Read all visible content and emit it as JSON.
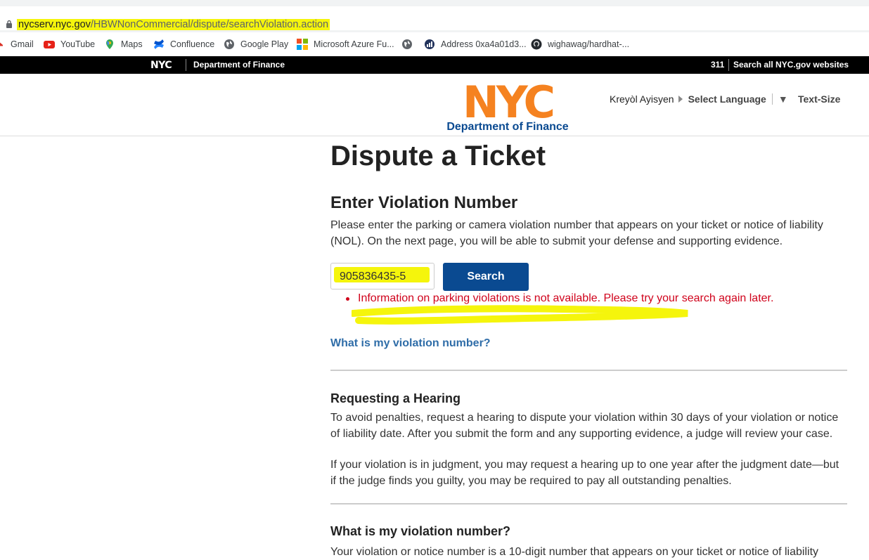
{
  "browser": {
    "url_domain": "nycserv.nyc.gov",
    "url_path": "/HBWNonCommercial/dispute/searchViolation.action",
    "bookmarks": [
      {
        "label": "Gmail",
        "icon": "gmail-icon"
      },
      {
        "label": "YouTube",
        "icon": "youtube-icon"
      },
      {
        "label": "Maps",
        "icon": "maps-icon"
      },
      {
        "label": "Confluence",
        "icon": "confluence-icon"
      },
      {
        "label": "Google Play",
        "icon": "globe-icon"
      },
      {
        "label": "Microsoft Azure Fu...",
        "icon": "microsoft-icon"
      },
      {
        "label": "",
        "icon": "globe-icon"
      },
      {
        "label": "Address 0xa4a01d3...",
        "icon": "etherscan-icon"
      },
      {
        "label": "wighawag/hardhat-...",
        "icon": "github-icon"
      }
    ]
  },
  "topbar": {
    "logo": "NYC",
    "department": "Department of Finance",
    "link_311": "311",
    "search_all": "Search all NYC.gov websites"
  },
  "header": {
    "logo_text": "NYC",
    "logo_subtitle": "Department of Finance",
    "language_current": "Kreyòl Ayisyen",
    "select_language": "Select Language",
    "text_size": "Text-Size"
  },
  "main": {
    "title": "Dispute a Ticket",
    "section_title": "Enter Violation Number",
    "intro": "Please enter the parking or camera violation number that appears on your ticket or notice of liability (NOL). On the next page, you will be able to submit your defense and supporting evidence.",
    "violation_input_value": "905836435-5",
    "search_button": "Search",
    "error_message": "Information on parking violations is not available. Please try your search again later.",
    "help_link": "What is my violation number?",
    "hearing_title": "Requesting a Hearing",
    "hearing_p1": "To avoid penalties, request a hearing to dispute your violation within 30 days of your violation or notice of liability date. After you submit the form and any supporting evidence, a judge will review your case.",
    "hearing_p2": "If your violation is in judgment, you may request a hearing up to one year after the judgment date—but if the judge finds you guilty, you may be required to pay all outstanding penalties.",
    "violation_title": "What is my violation number?",
    "violation_p": "Your violation or notice number is a 10-digit number that appears on your ticket or notice of liability"
  },
  "colors": {
    "highlight": "#f5f50c",
    "button_blue": "#0a4a91",
    "error_red": "#d0021b",
    "link_blue": "#2f6da8",
    "nyc_orange": "#f58220"
  }
}
